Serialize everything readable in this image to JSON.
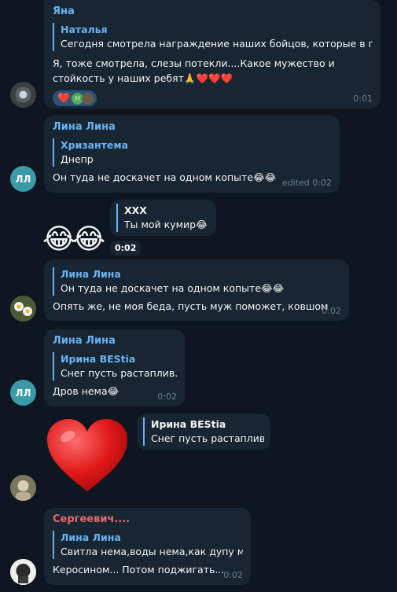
{
  "messages": [
    {
      "sender": "Яна",
      "reply_author": "Наталья",
      "reply_text": "Сегодня смотрела награждение наших бойцов, которые в го...",
      "text": "Я, тоже смотрела, слезы потекли....Какое мужество и стойкость у наших ребят🙏❤️❤️❤️",
      "reaction_emoji": "❤️",
      "reaction_avatar_letter": "Н",
      "time": "0:01"
    },
    {
      "sender": "Лина Лина",
      "avatar_initials": "ЛЛ",
      "reply_author": "Хризантема",
      "reply_text": "Днепр",
      "text": "Он туда не доскачет на одном копыте😂😂",
      "time": "edited 0:02"
    },
    {
      "reply_author": "ХХХ",
      "reply_text": "Ты мой кумир😂",
      "big_emoji": "😂😂",
      "time": "0:02"
    },
    {
      "reply_author": "Лина Лина",
      "reply_text": "Он туда не доскачет на одном копыте😂😂",
      "text": "Опять же, не моя беда, пусть муж поможет, ковшом",
      "time": "0:02"
    },
    {
      "sender": "Лина Лина",
      "avatar_initials": "ЛЛ",
      "reply_author": "Ирина BEStia",
      "reply_text": "Снег пусть растаплив...",
      "text": "Дров нема😂",
      "time": "0:02"
    },
    {
      "reply_author": "Ирина BEStia",
      "reply_text": "Снег пусть растаплив...",
      "big_emoji": "❤️"
    },
    {
      "sender": "Сергеевич....",
      "reply_author": "Лина Лина",
      "reply_text": "Свитла нема,воды нема,как дупу м...",
      "text": "Керосином... Потом поджигать...",
      "time": "0:02"
    }
  ]
}
